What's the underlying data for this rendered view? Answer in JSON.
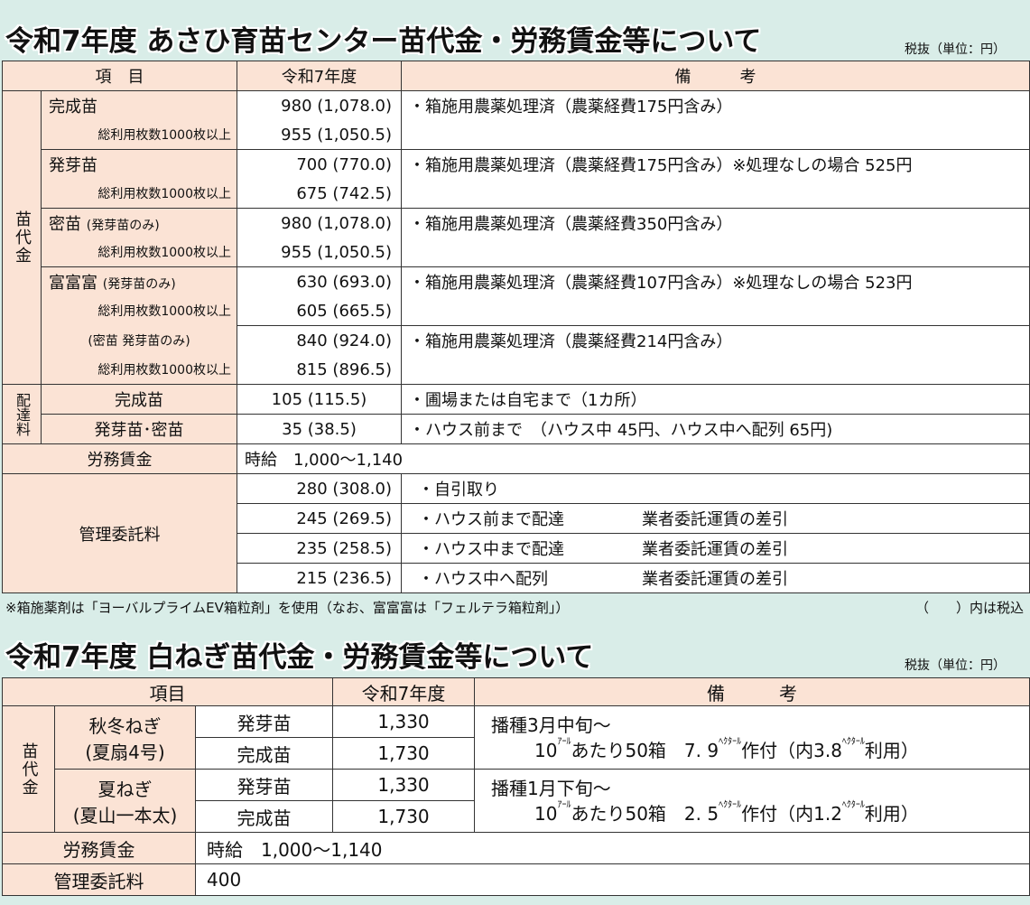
{
  "section1": {
    "title": "令和7年度 あさひ育苗センター苗代金・労務賃金等について",
    "unit": "税抜（単位：円）",
    "headers": {
      "item": "項　目",
      "year": "令和7年度",
      "remarks": "備　　　考"
    },
    "group_nae": "苗代金",
    "group_haitatsu": "配達料",
    "rows": {
      "kansei_label": "完成苗",
      "kansei_sub": "総利用枚数1000枚以上",
      "kansei_p1": "980 (1,078.0)",
      "kansei_p2": "955 (1,050.5)",
      "kansei_note": "・箱施用農薬処理済（農薬経費175円含み）",
      "hatsuga_label": "発芽苗",
      "hatsuga_sub": "総利用枚数1000枚以上",
      "hatsuga_p1": "700 (770.0)",
      "hatsuga_p2": "675 (742.5)",
      "hatsuga_note": "・箱施用農薬処理済（農薬経費175円含み）※処理なしの場合 525円",
      "mitsu_label": "密苗",
      "mitsu_label_sub": "(発芽苗のみ)",
      "mitsu_sub": "総利用枚数1000枚以上",
      "mitsu_p1": "980 (1,078.0)",
      "mitsu_p2": "955 (1,050.5)",
      "mitsu_note": "・箱施用農薬処理済（農薬経費350円含み）",
      "fufu_label": "富富富",
      "fufu_label_sub": "(発芽苗のみ)",
      "fufu_sub": "総利用枚数1000枚以上",
      "fufu_p1": "630 (693.0)",
      "fufu_p2": "605 (665.5)",
      "fufu_note": "・箱施用農薬処理済（農薬経費107円含み）※処理なしの場合 523円",
      "fufu2_label": "(密苗 発芽苗のみ)",
      "fufu2_sub": "総利用枚数1000枚以上",
      "fufu2_p1": "840 (924.0)",
      "fufu2_p2": "815 (896.5)",
      "fufu2_note": "・箱施用農薬処理済（農薬経費214円含み）",
      "deliv1_label": "完成苗",
      "deliv1_price": "105 (115.5)",
      "deliv1_note": "・圃場または自宅まで（1カ所）",
      "deliv2_label": "発芽苗･密苗",
      "deliv2_price": "35 (38.5)",
      "deliv2_note": "・ハウス前まで　（ハウス中 45円、ハウス中へ配列 65円)",
      "labor_label": "労務賃金",
      "labor_value": "時給　1,000～1,140",
      "mgmt_label": "管理委託料",
      "mgmt": [
        {
          "price": "280 (308.0)",
          "note": "・自引取り",
          "extra": ""
        },
        {
          "price": "245 (269.5)",
          "note": "・ハウス前まで配達",
          "extra": "業者委託運賃の差引"
        },
        {
          "price": "235 (258.5)",
          "note": "・ハウス中まで配達",
          "extra": "業者委託運賃の差引"
        },
        {
          "price": "215 (236.5)",
          "note": "・ハウス中へ配列",
          "extra": "業者委託運賃の差引"
        }
      ]
    },
    "footnote": "※箱施薬剤は「ヨーバルプライムEV箱粒剤」を使用（なお、富富富は「フェルテラ箱粒剤」）",
    "tax_note": "（　　）内は税込"
  },
  "section2": {
    "title": "令和7年度 白ねぎ苗代金・労務賃金等について",
    "unit": "税抜（単位：円）",
    "headers": {
      "item": "項目",
      "year": "令和7年度",
      "remarks": "備　　　考"
    },
    "group": "苗代金",
    "akifuyu_name": "秋冬ねぎ",
    "akifuyu_variety": "(夏扇4号)",
    "natsu_name": "夏ねぎ",
    "natsu_variety": "(夏山一本太)",
    "hatsuga": "発芽苗",
    "kansei": "完成苗",
    "akifuyu_hatsuga_price": "1,330",
    "akifuyu_kansei_price": "1,730",
    "natsu_hatsuga_price": "1,330",
    "natsu_kansei_price": "1,730",
    "akifuyu_note1": "播種3月中旬～",
    "akifuyu_note2_a": "10",
    "akifuyu_note2_unit": "ｱｰﾙ",
    "akifuyu_note2_b": "あたり50箱　7. 9",
    "akifuyu_note2_unit2": "ﾍｸﾀｰﾙ",
    "akifuyu_note2_c": "作付（内3.8",
    "akifuyu_note2_unit3": "ﾍｸﾀｰﾙ",
    "akifuyu_note2_d": "利用）",
    "natsu_note1": "播種1月下旬～",
    "natsu_note2_a": "10",
    "natsu_note2_unit": "ｱｰﾙ",
    "natsu_note2_b": "あたり50箱　2. 5",
    "natsu_note2_unit2": "ﾍｸﾀｰﾙ",
    "natsu_note2_c": "作付（内1.2",
    "natsu_note2_unit3": "ﾍｸﾀｰﾙ",
    "natsu_note2_d": "利用）",
    "labor_label": "労務賃金",
    "labor_value": "時給　1,000～1,140",
    "mgmt_label": "管理委託料",
    "mgmt_value": "400"
  }
}
